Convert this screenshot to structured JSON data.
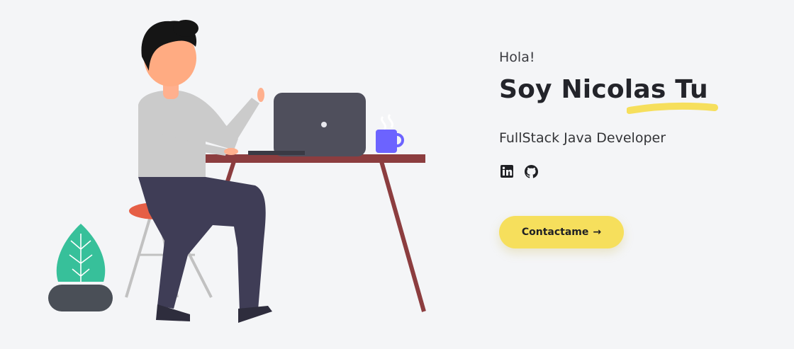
{
  "hero": {
    "greeting": "Hola!",
    "name": "Soy Nicolas Tu",
    "role": "FullStack Java Developer",
    "cta_label": "Contactame",
    "cta_arrow": "→"
  },
  "socials": [
    {
      "icon": "linkedin-icon"
    },
    {
      "icon": "github-icon"
    }
  ],
  "colors": {
    "background": "#f4f5f7",
    "accent": "#f6df5c",
    "heading": "#23242a"
  }
}
